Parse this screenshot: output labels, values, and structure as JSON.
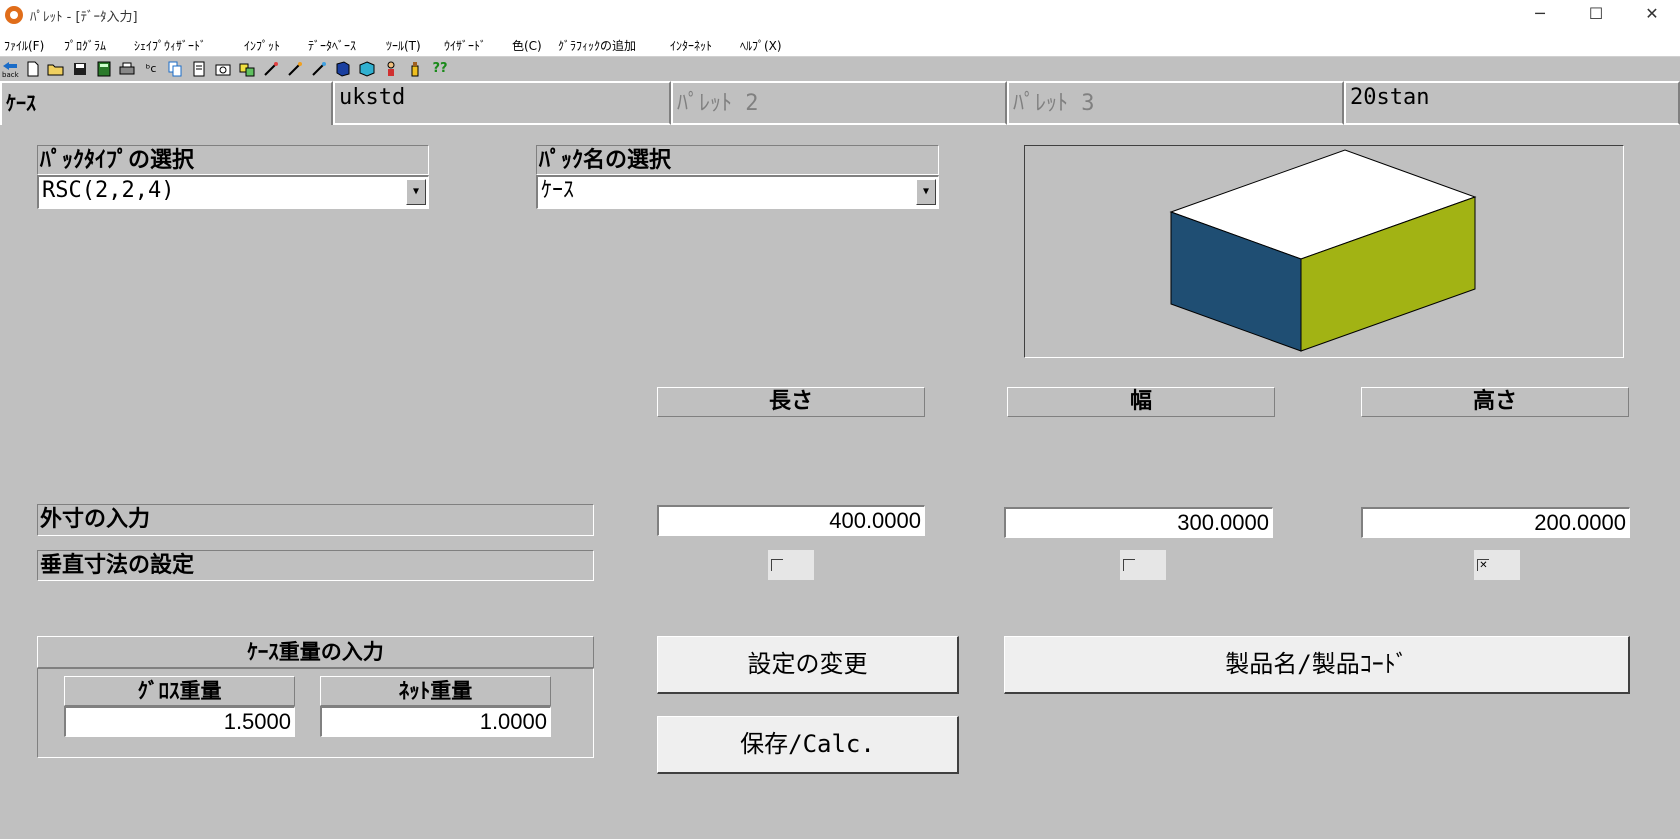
{
  "window": {
    "title": "ﾊﾟﾚｯﾄ - [ﾃﾞｰﾀ入力]",
    "minimize": "─",
    "maximize": "☐",
    "close": "✕"
  },
  "menu": [
    "ﾌｧｲﾙ(F)",
    "ﾌﾟﾛｸﾞﾗﾑ",
    "ｼｪｲﾌﾟｳｨｻﾞｰﾄﾞ",
    "ｲﾝﾌﾟｯﾄ",
    "ﾃﾞｰﾀﾍﾞｰｽ",
    "ﾂｰﾙ(T)",
    "ｳｲｻﾞｰﾄﾞ",
    "色(C)",
    "ｸﾞﾗﾌｨｯｸの追加",
    "ｲﾝﾀｰﾈｯﾄ",
    "ﾍﾙﾌﾟ(X)"
  ],
  "toolbar": {
    "back_label": "back",
    "icons": [
      "back-icon",
      "new-file-icon",
      "open-folder-icon",
      "save-icon",
      "calculator-icon",
      "print-icon",
      "abc-icon",
      "copy-icon",
      "document-icon",
      "camera-icon",
      "shapes-icon",
      "wand-icon",
      "wand2-icon",
      "wand3-icon",
      "book-icon",
      "cube-icon",
      "person-icon",
      "bottle-icon",
      "help-icon"
    ],
    "help_glyph": "??"
  },
  "tabs": [
    {
      "label": "ｹｰｽ",
      "state": "active"
    },
    {
      "label": "ukstd",
      "state": "normal"
    },
    {
      "label": "ﾊﾟﾚｯﾄ 2",
      "state": "disabled"
    },
    {
      "label": "ﾊﾟﾚｯﾄ 3",
      "state": "disabled"
    },
    {
      "label": "20stan",
      "state": "normal"
    }
  ],
  "pack_type": {
    "label": "ﾊﾟｯｸﾀｲﾌﾟの選択",
    "value": "RSC(2,2,4)"
  },
  "pack_name": {
    "label": "ﾊﾟｯｸ名の選択",
    "value": "ｹｰｽ"
  },
  "dimensions": {
    "headers": {
      "length": "長さ",
      "width": "幅",
      "height": "高さ"
    },
    "outer_label": "外寸の入力",
    "vertical_label": "垂直寸法の設定",
    "values": {
      "length": "400.0000",
      "width": "300.0000",
      "height": "200.0000"
    },
    "vertical_checks": {
      "length": false,
      "width": false,
      "height": true
    }
  },
  "weight": {
    "title": "ｹｰｽ重量の入力",
    "gross_label": "ｸﾞﾛｽ重量",
    "net_label": "ﾈｯﾄ重量",
    "gross_value": "1.5000",
    "net_value": "1.0000"
  },
  "buttons": {
    "change_settings": "設定の変更",
    "product_code": "製品名/製品ｺｰﾄﾞ",
    "save_calc": "保存/Calc."
  },
  "colors": {
    "box_top": "#ffffff",
    "box_left": "#1f4e73",
    "box_right": "#a2b314",
    "background": "#c0c0c0"
  }
}
